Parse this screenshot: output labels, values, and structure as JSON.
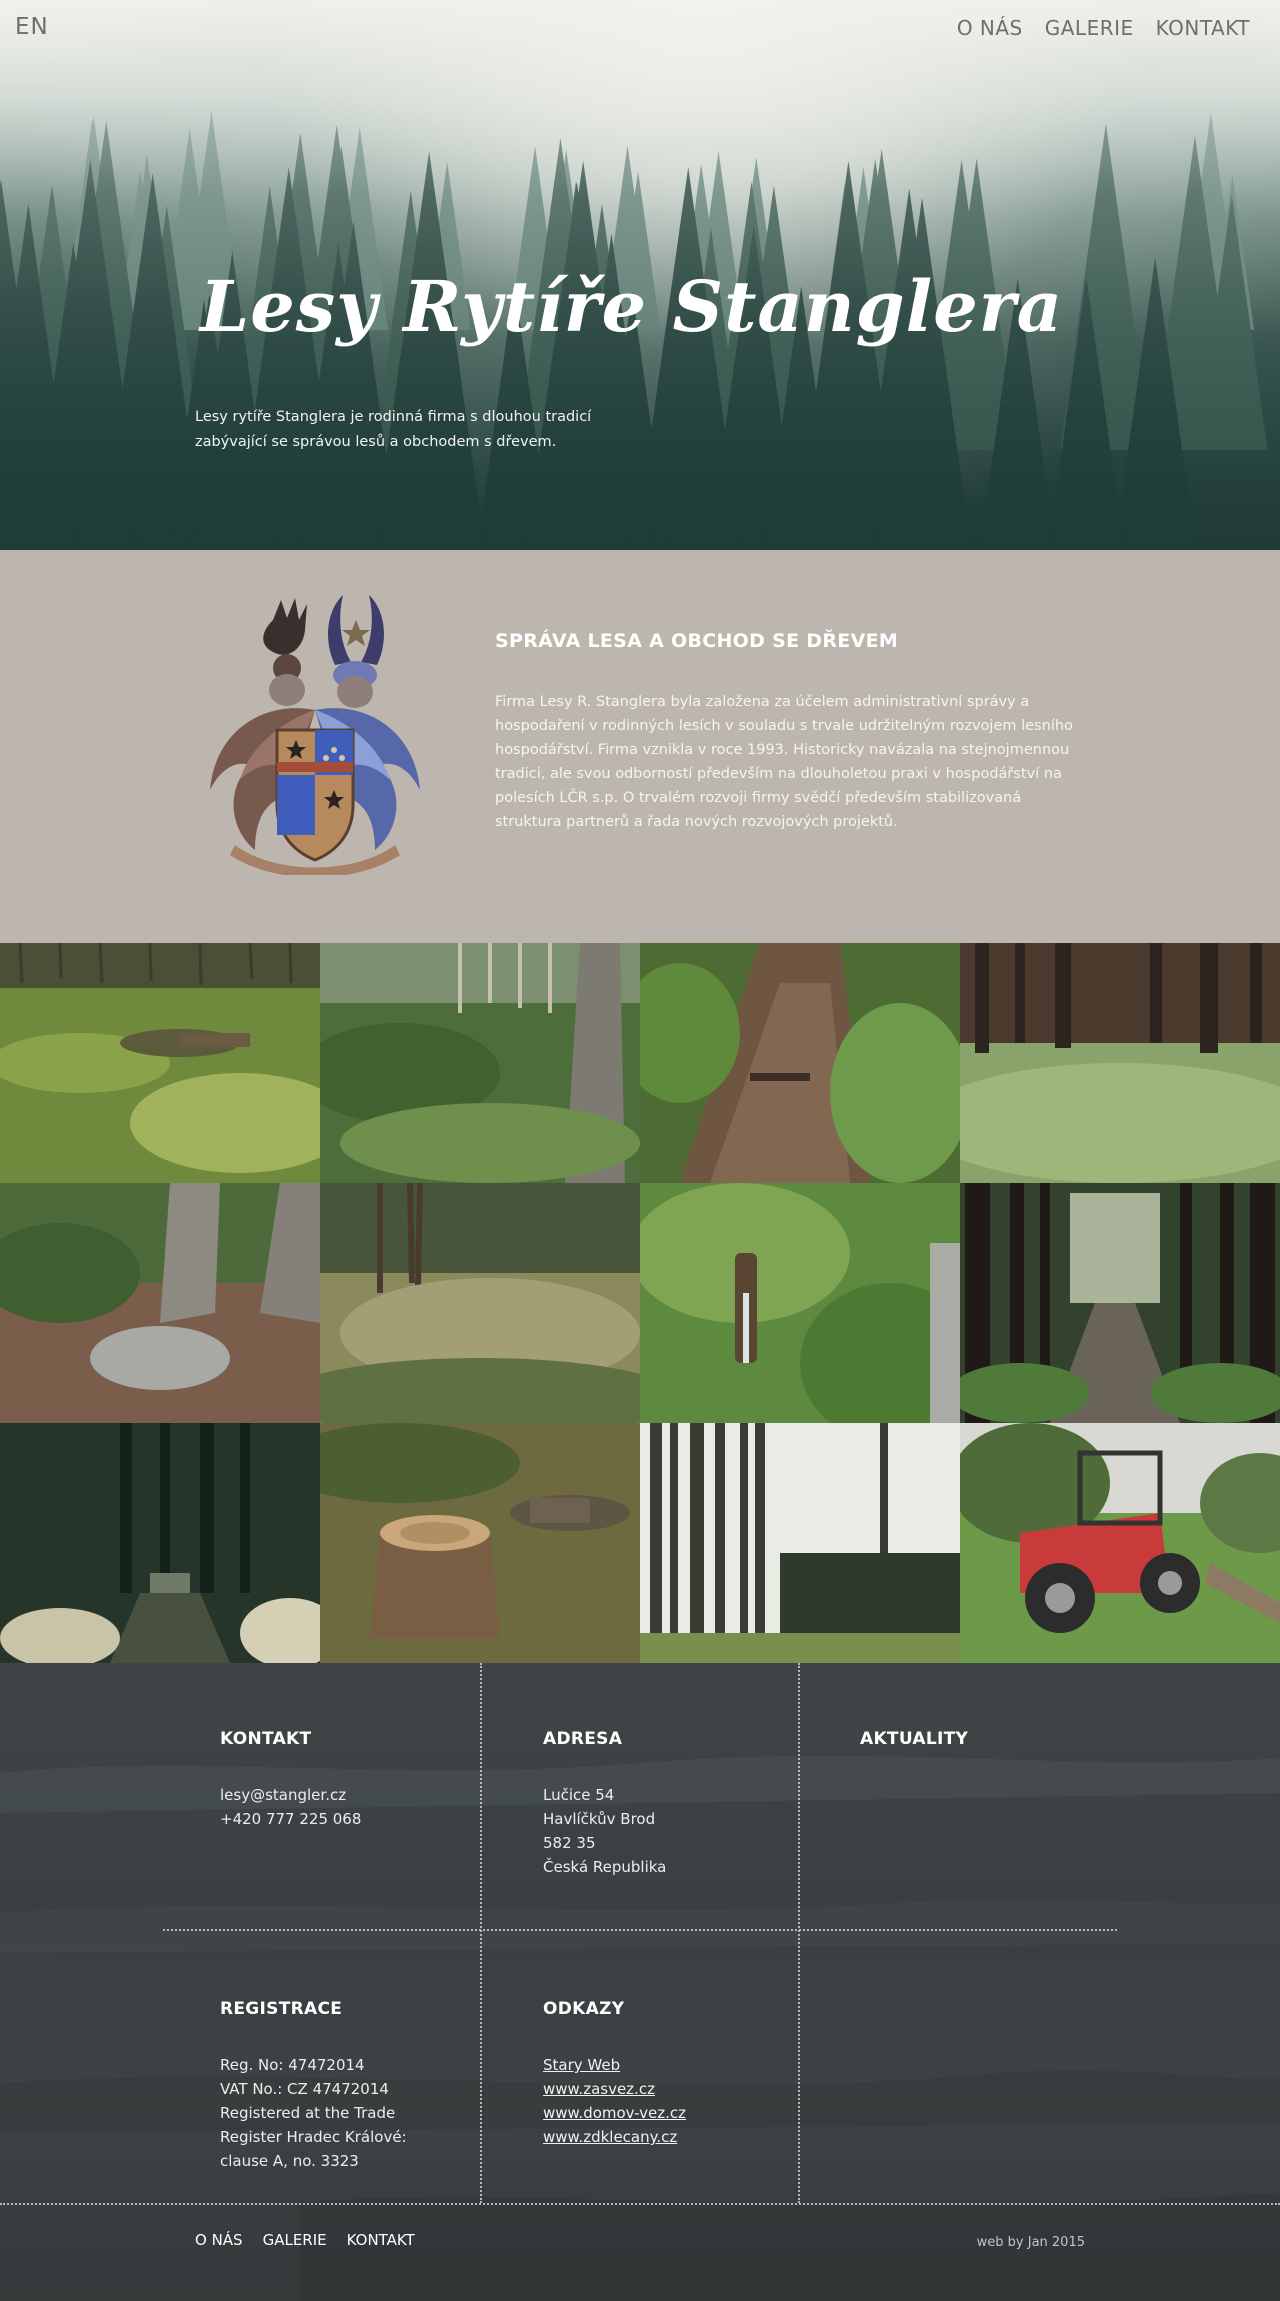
{
  "header": {
    "lang": "EN",
    "nav": [
      "O NÁS",
      "GALERIE",
      "KONTAKT"
    ]
  },
  "hero": {
    "title": "Lesy Rytíře Stanglera",
    "subtitle_line1": "Lesy rytíře Stanglera je rodinná firma s dlouhou tradicí",
    "subtitle_line2": "zabývající se správou lesů a obchodem s dřevem."
  },
  "about": {
    "heading": "SPRÁVA LESA A OBCHOD SE DŘEVEM",
    "lines": [
      "Firma Lesy R. Stanglera byla založena za účelem administrativní správy a",
      "hospodaření v rodinných lesích v souladu s trvale udržitelným rozvojem lesního",
      "hospodářství. Firma vznikla v roce 1993. Historicky navázala na stejnojmennou",
      "tradici, ale svou odborností především na dlouholetou praxi v hospodářství na",
      "polesích LČR s.p. O trvalém rozvoji firmy svědčí především stabilizovaná",
      "struktura partnerů a řada nových rozvojových projektů."
    ]
  },
  "gallery": {
    "tiles": [
      "forest-floor-moss",
      "spruce-trunk-grass",
      "forest-stream",
      "forest-meadow",
      "boulder-path",
      "dry-grass-clearing",
      "water-spring",
      "forest-road",
      "dark-forest-path",
      "tree-stump",
      "tall-pines",
      "red-tractor"
    ]
  },
  "footer": {
    "kontakt": {
      "heading": "KONTAKT",
      "email": "lesy@stangler.cz",
      "phone": "+420 777 225 068"
    },
    "adresa": {
      "heading": "ADRESA",
      "lines": [
        "Lučice 54",
        "Havlíčkův Brod",
        "582 35",
        "Česká Republika"
      ]
    },
    "aktuality": {
      "heading": "AKTUALITY"
    },
    "registrace": {
      "heading": "REGISTRACE",
      "lines": [
        "Reg. No: 47472014",
        "VAT No.: CZ 47472014",
        "Registered at the Trade",
        "Register Hradec Králové:",
        "clause A, no. 3323"
      ]
    },
    "odkazy": {
      "heading": "ODKAZY",
      "links": [
        "Stary Web",
        "www.zasvez.cz",
        "www.domov-vez.cz",
        "www.zdklecany.cz"
      ]
    },
    "bottom_nav": [
      "O NÁS",
      "GALERIE",
      "KONTAKT"
    ],
    "credit": "web by Jan 2015"
  }
}
